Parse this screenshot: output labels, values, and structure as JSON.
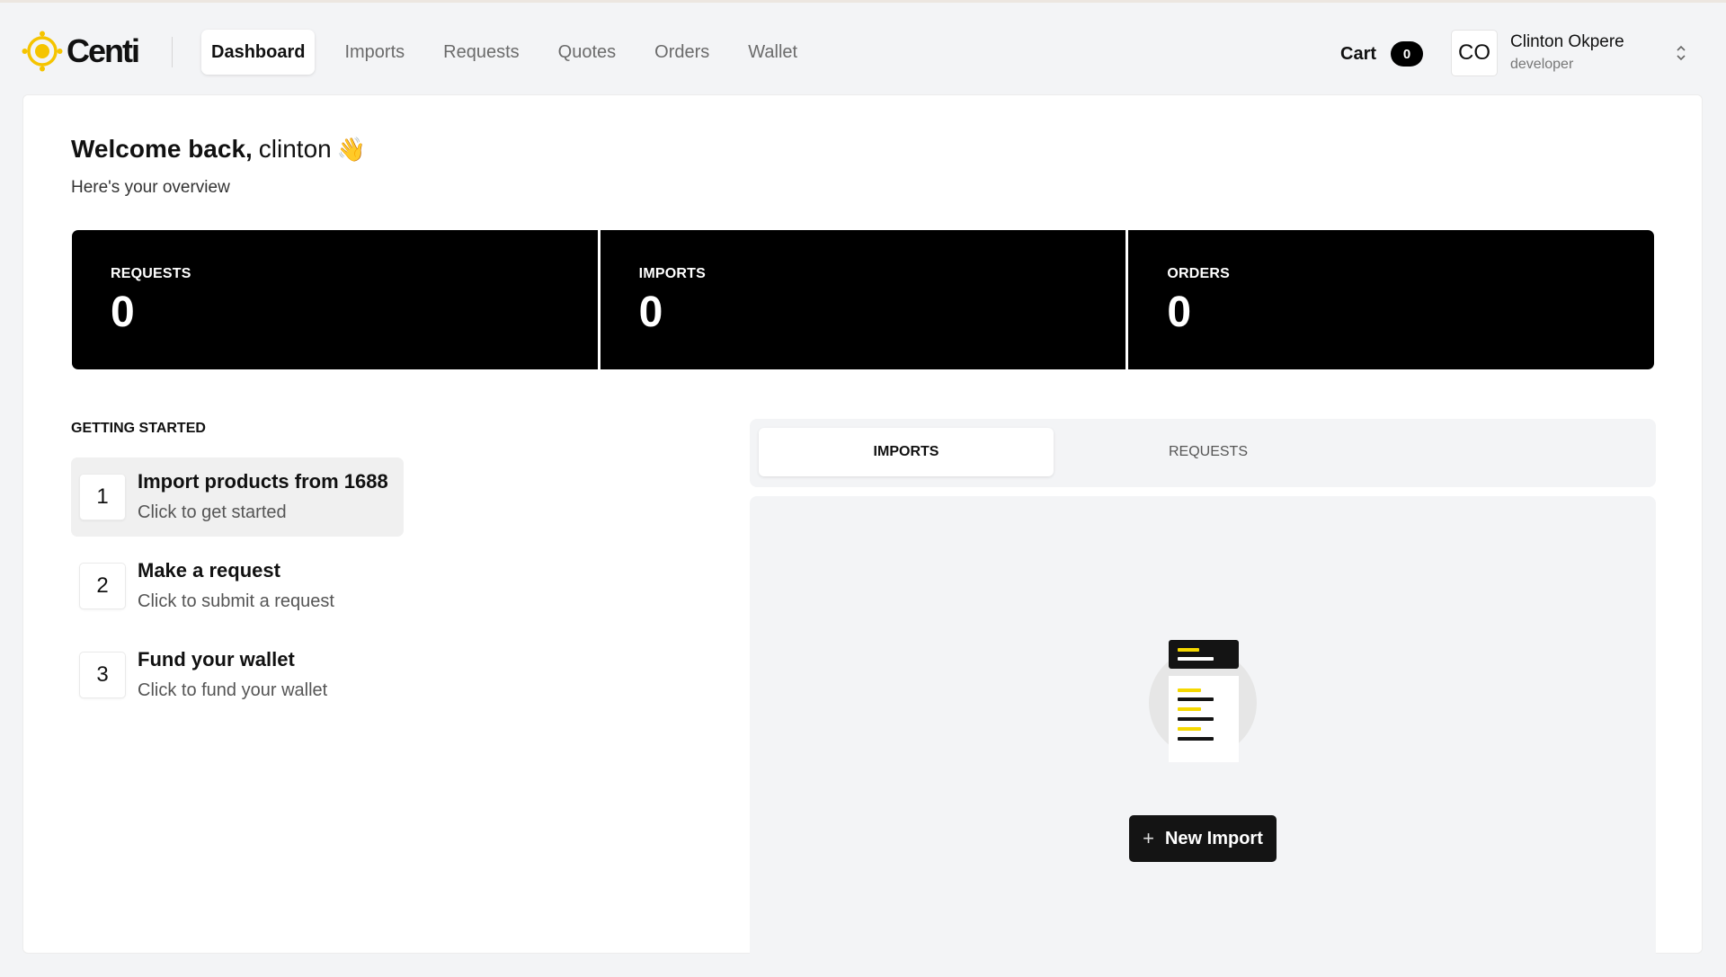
{
  "brand": {
    "name": "Centi",
    "logo_icon": "centi-sun-logo",
    "accent": "#f5c400"
  },
  "nav": {
    "tabs": [
      {
        "label": "Dashboard",
        "active": true
      },
      {
        "label": "Imports"
      },
      {
        "label": "Requests"
      },
      {
        "label": "Quotes"
      },
      {
        "label": "Orders"
      },
      {
        "label": "Wallet"
      }
    ]
  },
  "cart": {
    "label": "Cart",
    "count": "0"
  },
  "user": {
    "initials": "CO",
    "name": "Clinton Okpere",
    "role": "developer",
    "menu_icon": "chevron-up-down-icon"
  },
  "welcome": {
    "prefix": "Welcome back,",
    "name": "clinton",
    "emoji": "👋",
    "subtitle": "Here's your overview"
  },
  "stats": [
    {
      "label": "REQUESTS",
      "value": "0"
    },
    {
      "label": "IMPORTS",
      "value": "0"
    },
    {
      "label": "ORDERS",
      "value": "0"
    }
  ],
  "getting_started": {
    "title": "GETTING STARTED",
    "steps": [
      {
        "num": "1",
        "title": "Import products from 1688",
        "subtitle": "Click to get started",
        "active": true
      },
      {
        "num": "2",
        "title": "Make a request",
        "subtitle": "Click to submit a request"
      },
      {
        "num": "3",
        "title": "Fund your wallet",
        "subtitle": "Click to fund your wallet"
      }
    ]
  },
  "panel": {
    "tabs": [
      {
        "label": "IMPORTS",
        "active": true
      },
      {
        "label": "REQUESTS"
      }
    ],
    "empty_icon": "document-list-illustration",
    "new_button_label": "New Import",
    "colors": {
      "dark": "#141414",
      "highlight": "#f5d800"
    }
  }
}
